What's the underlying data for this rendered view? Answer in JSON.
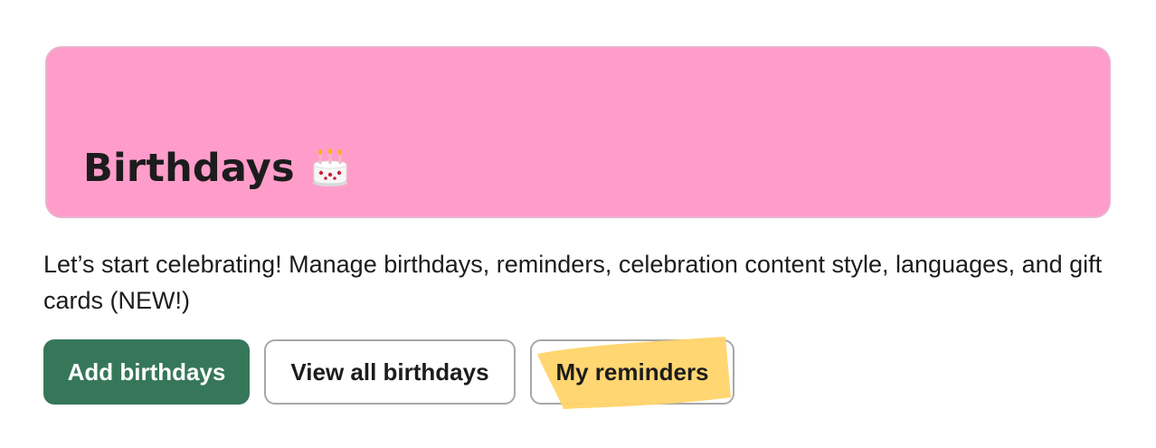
{
  "banner": {
    "title": "Birthdays",
    "background": "#ff9dca",
    "icon": "birthday-cake-icon"
  },
  "description": "Let’s start celebrating! Manage birthdays, reminders, celebration content style, languages, and gift cards (NEW!)",
  "actions": {
    "add_birthdays": "Add birthdays",
    "view_all_birthdays": "View all birthdays",
    "my_reminders": "My reminders"
  },
  "colors": {
    "primary_button": "#36775a",
    "highlight": "#ffd46b",
    "text": "#1d1c1d"
  }
}
